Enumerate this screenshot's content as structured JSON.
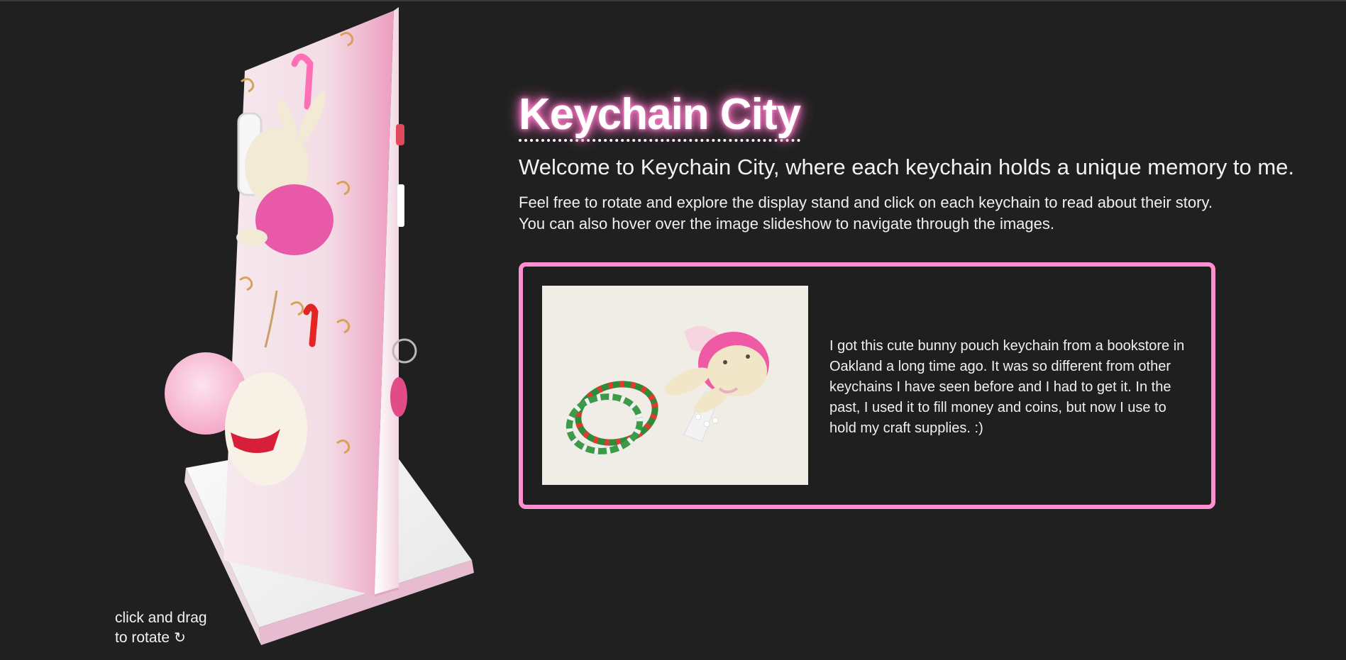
{
  "page": {
    "title": "Keychain City",
    "subtitle": "Welcome to Keychain City, where each keychain holds a unique memory to me.",
    "intro": "Feel free to rotate and explore the display stand and click on each keychain to read about their story. You can also hover over the image slideshow to navigate through the images."
  },
  "viewer": {
    "hint_line1": "click and drag",
    "hint_line2": "to rotate",
    "rotate_icon": "↻"
  },
  "story": {
    "text": "I got this cute bunny pouch keychain from a bookstore in Oakland a long time ago. It was so different from other keychains I have seen before and I had to get it. In the past, I used it to fill money and coins, but now I use to hold my craft supplies. :)"
  },
  "colors": {
    "background": "#202020",
    "accent_pink": "#ff8fd0",
    "text": "#ffffff"
  },
  "icons": {
    "rotate": "rotate-icon"
  }
}
